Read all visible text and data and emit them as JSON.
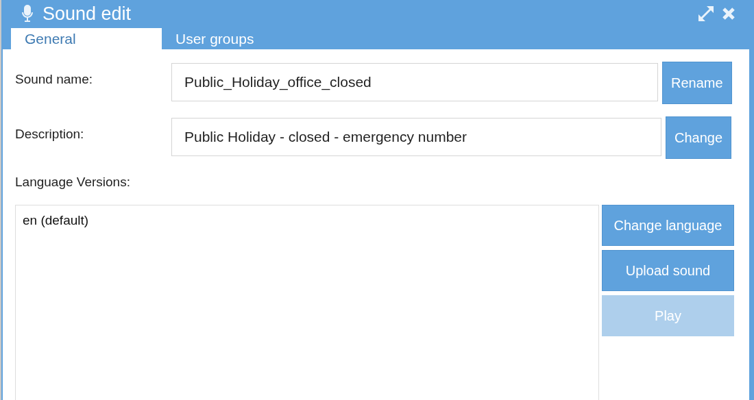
{
  "window": {
    "title": "Sound edit"
  },
  "tabs": [
    {
      "label": "General",
      "selected": true
    },
    {
      "label": "User groups",
      "selected": false
    }
  ],
  "fields": [
    {
      "label": "Sound name:",
      "value": "Public_Holiday_office_closed",
      "button": "Rename"
    },
    {
      "label": "Description:",
      "value": "Public Holiday - closed - emergency number",
      "button": "Change"
    }
  ],
  "language_versions": {
    "label": "Language Versions:",
    "items": [
      {
        "label": "en (default)",
        "selected": false
      }
    ],
    "buttons": [
      {
        "label": "Change language",
        "disabled": false
      },
      {
        "label": "Upload sound",
        "disabled": false
      },
      {
        "label": "Play",
        "disabled": true
      }
    ]
  }
}
